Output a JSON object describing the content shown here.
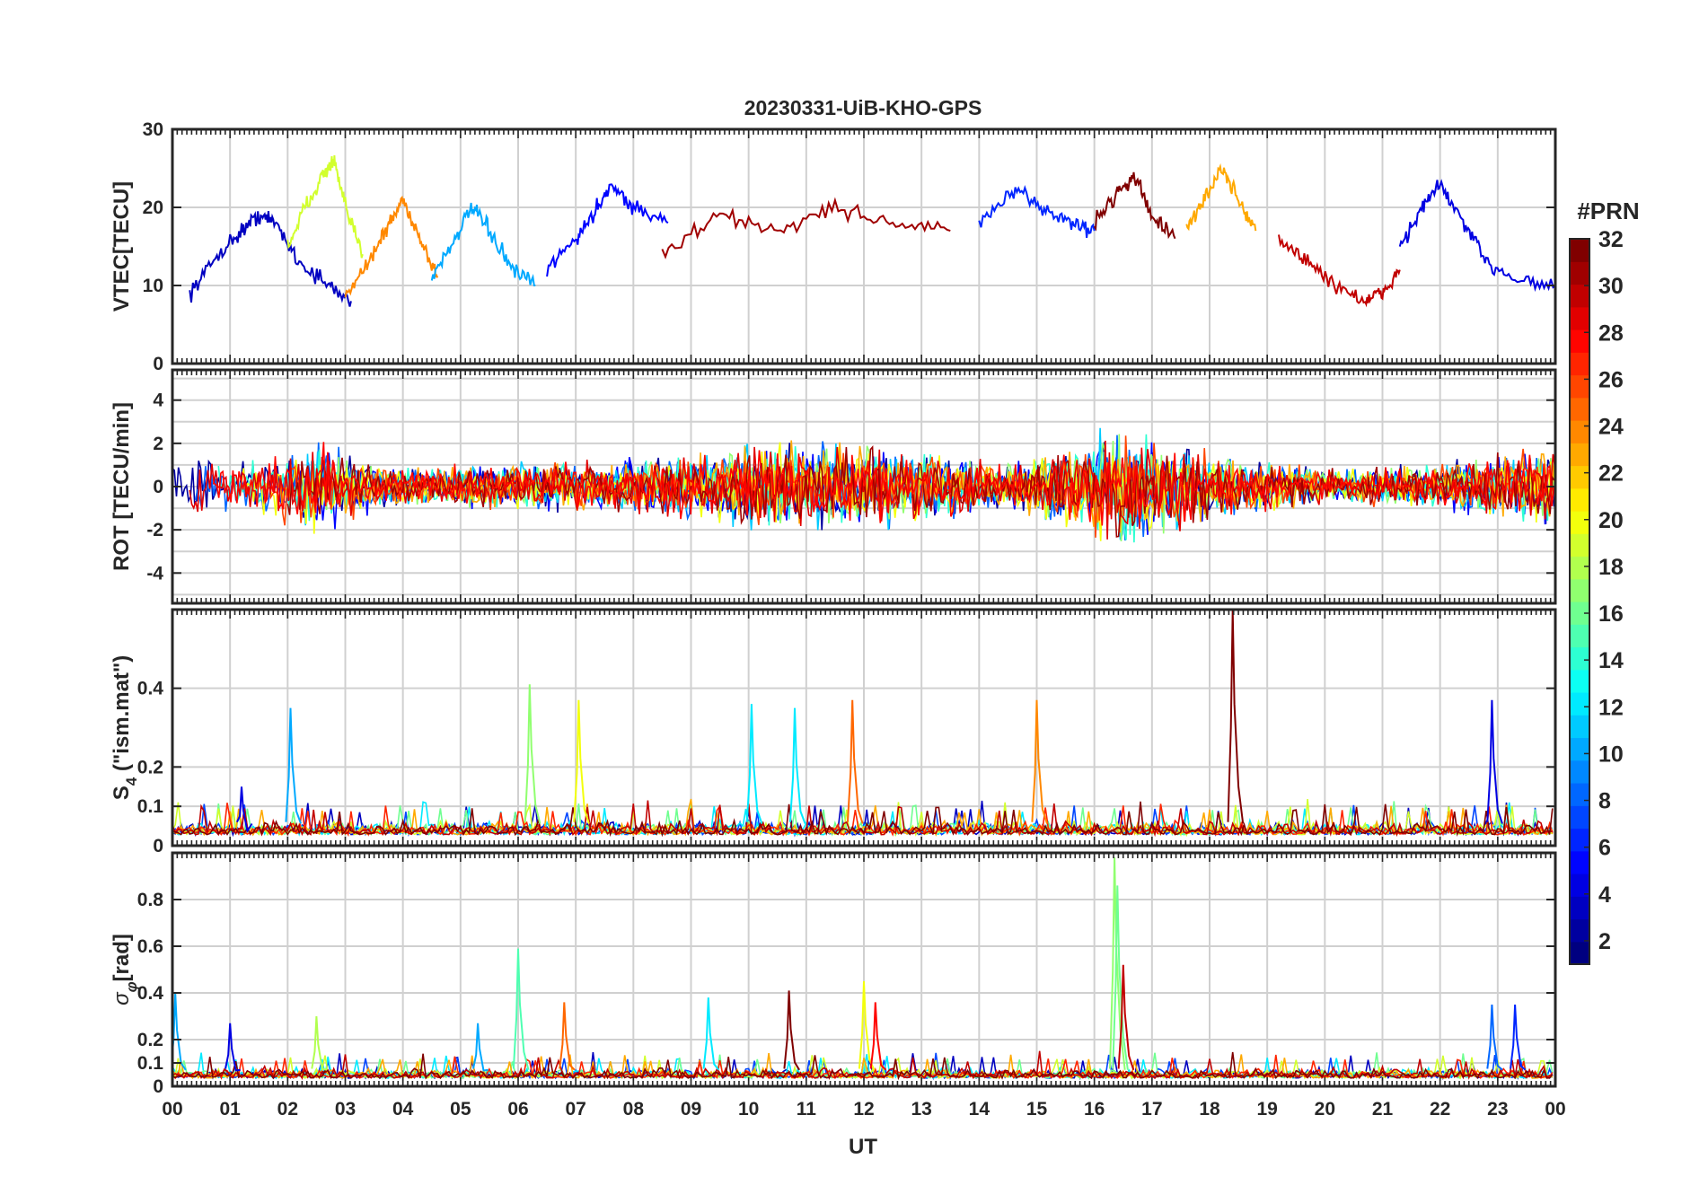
{
  "figure": {
    "title": "20230331-UiB-KHO-GPS"
  },
  "colorbar": {
    "label": "#PRN",
    "colormap": "jet",
    "range": [
      1,
      32
    ],
    "ticks": [
      "2",
      "4",
      "6",
      "8",
      "10",
      "12",
      "14",
      "16",
      "18",
      "20",
      "22",
      "24",
      "26",
      "28",
      "30",
      "32"
    ]
  },
  "chart_data": [
    {
      "type": "line",
      "id": "vtec",
      "ylabel": "VTEC[TECU]",
      "ylim": [
        0,
        30
      ],
      "yticks": [
        "0",
        "10",
        "20",
        "30"
      ],
      "grid": true,
      "x_range_ut": [
        "00",
        "00"
      ],
      "x_range_hours": [
        0,
        24
      ],
      "color_by": "PRN",
      "series": [
        {
          "prn": 3,
          "x": [
            0.3,
            0.8,
            1.2,
            1.5,
            1.8,
            2.2,
            2.7,
            3.1
          ],
          "y": [
            9,
            14,
            17,
            19,
            18,
            13,
            10,
            8
          ]
        },
        {
          "prn": 19,
          "x": [
            2.0,
            2.3,
            2.6,
            2.8,
            3.0,
            3.3
          ],
          "y": [
            15,
            20,
            24,
            26,
            20,
            14
          ]
        },
        {
          "prn": 24,
          "x": [
            3.0,
            3.4,
            3.7,
            4.0,
            4.3,
            4.6
          ],
          "y": [
            9,
            13,
            17,
            21,
            16,
            11
          ]
        },
        {
          "prn": 10,
          "x": [
            4.5,
            4.9,
            5.2,
            5.5,
            5.9,
            6.3
          ],
          "y": [
            11,
            16,
            20,
            17,
            12,
            10
          ]
        },
        {
          "prn": 5,
          "x": [
            6.5,
            7.0,
            7.3,
            7.6,
            8.0,
            8.6
          ],
          "y": [
            12,
            16,
            19,
            23,
            20,
            18
          ]
        },
        {
          "prn": 31,
          "x": [
            8.5,
            9.5,
            10.5,
            11.5,
            12.5,
            13.5
          ],
          "y": [
            14,
            19,
            17,
            20,
            18,
            17
          ]
        },
        {
          "prn": 6,
          "x": [
            14.0,
            14.6,
            15.1,
            15.6,
            16.0
          ],
          "y": [
            18,
            22,
            20,
            18,
            17
          ]
        },
        {
          "prn": 32,
          "x": [
            16.0,
            16.4,
            16.7,
            17.0,
            17.4
          ],
          "y": [
            18,
            22,
            24,
            19,
            16
          ]
        },
        {
          "prn": 23,
          "x": [
            17.6,
            17.9,
            18.2,
            18.5,
            18.8
          ],
          "y": [
            17,
            21,
            25,
            21,
            17
          ]
        },
        {
          "prn": 30,
          "x": [
            19.2,
            19.7,
            20.2,
            20.7,
            21.0,
            21.3
          ],
          "y": [
            16,
            13,
            10,
            8,
            9,
            12
          ]
        },
        {
          "prn": 4,
          "x": [
            21.3,
            21.7,
            22.0,
            22.4,
            22.8,
            23.3,
            24.0
          ],
          "y": [
            15,
            20,
            23,
            18,
            13,
            11,
            10
          ]
        }
      ],
      "notes_visual": "VTEC mostly 7-12 TECU from 00-06 UT, rising to ~15-20 TECU from 08-19 UT, dipping to ~8 near 21 UT then ~10-20 to end of day"
    },
    {
      "type": "line",
      "id": "rot",
      "ylabel": "ROT [TECU/min]",
      "ylim": [
        -5.4,
        5.4
      ],
      "yticks": [
        "-4",
        "-2",
        "0",
        "2",
        "4"
      ],
      "grid": true,
      "color_by": "PRN",
      "noise_profile": [
        {
          "x": 0,
          "amp": 2.4
        },
        {
          "x": 1,
          "amp": 1.4
        },
        {
          "x": 2.5,
          "amp": 2.5
        },
        {
          "x": 4,
          "amp": 1.1
        },
        {
          "x": 6,
          "amp": 1.4
        },
        {
          "x": 8,
          "amp": 1.6
        },
        {
          "x": 9.5,
          "amp": 2.2
        },
        {
          "x": 11,
          "amp": 3.0
        },
        {
          "x": 13,
          "amp": 2.0
        },
        {
          "x": 14.5,
          "amp": 1.3
        },
        {
          "x": 16.5,
          "amp": 3.5
        },
        {
          "x": 18,
          "amp": 2.0
        },
        {
          "x": 20,
          "amp": 1.0
        },
        {
          "x": 22,
          "amp": 1.4
        },
        {
          "x": 24,
          "amp": 2.4
        }
      ]
    },
    {
      "type": "line",
      "id": "s4",
      "ylabel": "S4 (\"ism.mat\")",
      "ylabel_main": "S",
      "ylabel_sub": "4",
      "ylabel_rest": " (\"ism.mat\")",
      "ylim": [
        0,
        0.6
      ],
      "yticks": [
        "0",
        "0.1",
        "0.2",
        "0.4"
      ],
      "ytick_values": [
        0,
        0.1,
        0.2,
        0.4
      ],
      "grid": true,
      "color_by": "PRN",
      "baseline": 0.04,
      "spikes": [
        {
          "x": 2.05,
          "y": 0.35,
          "prn": 10
        },
        {
          "x": 1.2,
          "y": 0.15,
          "prn": 4
        },
        {
          "x": 6.2,
          "y": 0.41,
          "prn": 17
        },
        {
          "x": 7.05,
          "y": 0.37,
          "prn": 20
        },
        {
          "x": 10.05,
          "y": 0.36,
          "prn": 12
        },
        {
          "x": 10.8,
          "y": 0.35,
          "prn": 12
        },
        {
          "x": 11.8,
          "y": 0.37,
          "prn": 25
        },
        {
          "x": 15.0,
          "y": 0.37,
          "prn": 24
        },
        {
          "x": 18.4,
          "y": 0.6,
          "prn": 32
        },
        {
          "x": 22.9,
          "y": 0.37,
          "prn": 4
        }
      ]
    },
    {
      "type": "line",
      "id": "sigma_phi",
      "ylabel": "σφ[rad]",
      "ylabel_main": "σ",
      "ylabel_sub": "φ",
      "ylabel_rest": "[rad]",
      "ylim": [
        0,
        1.0
      ],
      "yticks": [
        "0",
        "0.1",
        "0.2",
        "0.4",
        "0.6",
        "0.8"
      ],
      "ytick_values": [
        0,
        0.1,
        0.2,
        0.4,
        0.6,
        0.8
      ],
      "grid": true,
      "color_by": "PRN",
      "baseline": 0.05,
      "spikes": [
        {
          "x": 0.05,
          "y": 0.4,
          "prn": 10
        },
        {
          "x": 1.0,
          "y": 0.27,
          "prn": 4
        },
        {
          "x": 2.5,
          "y": 0.3,
          "prn": 18
        },
        {
          "x": 5.3,
          "y": 0.27,
          "prn": 10
        },
        {
          "x": 6.0,
          "y": 0.59,
          "prn": 15
        },
        {
          "x": 6.8,
          "y": 0.36,
          "prn": 25
        },
        {
          "x": 9.3,
          "y": 0.38,
          "prn": 12
        },
        {
          "x": 10.7,
          "y": 0.41,
          "prn": 32
        },
        {
          "x": 12.0,
          "y": 0.45,
          "prn": 20
        },
        {
          "x": 12.2,
          "y": 0.36,
          "prn": 28
        },
        {
          "x": 16.35,
          "y": 0.98,
          "prn": 17
        },
        {
          "x": 16.4,
          "y": 0.86,
          "prn": 16
        },
        {
          "x": 16.5,
          "y": 0.52,
          "prn": 30
        },
        {
          "x": 22.9,
          "y": 0.35,
          "prn": 8
        },
        {
          "x": 23.3,
          "y": 0.35,
          "prn": 6
        }
      ]
    }
  ],
  "xaxis": {
    "label": "UT",
    "ticks": [
      "00",
      "01",
      "02",
      "03",
      "04",
      "05",
      "06",
      "07",
      "08",
      "09",
      "10",
      "11",
      "12",
      "13",
      "14",
      "15",
      "16",
      "17",
      "18",
      "19",
      "20",
      "21",
      "22",
      "23",
      "00"
    ]
  }
}
